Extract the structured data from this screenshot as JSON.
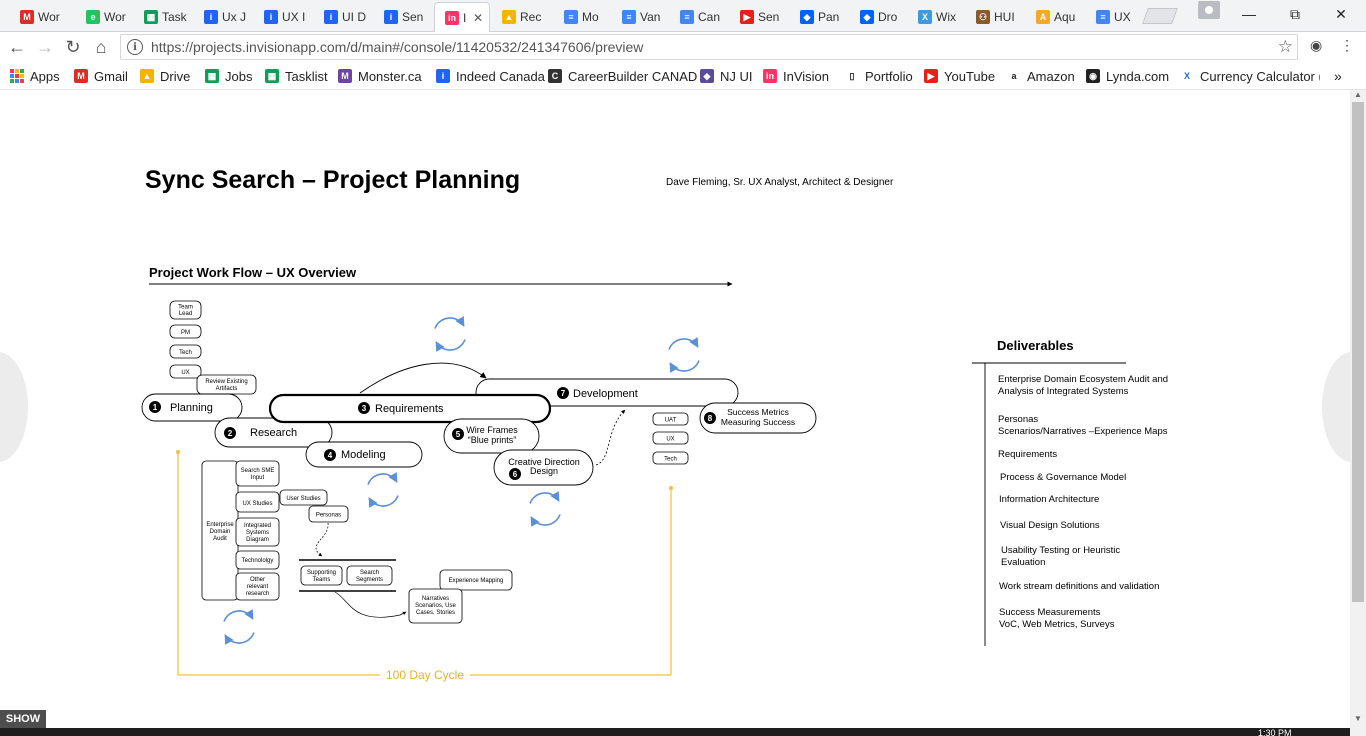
{
  "browser": {
    "tabs": [
      {
        "title": "Wor",
        "icon": "gmail-icon",
        "color": "#d93025",
        "glyph": "M"
      },
      {
        "title": "Wor",
        "icon": "evernote-icon",
        "color": "#2dbe60",
        "glyph": "e"
      },
      {
        "title": "Task",
        "icon": "sheets-icon",
        "color": "#0f9d58",
        "glyph": "▦"
      },
      {
        "title": "Ux J",
        "icon": "indeed-icon",
        "color": "#2164f3",
        "glyph": "i"
      },
      {
        "title": "UX I",
        "icon": "indeed-icon",
        "color": "#2164f3",
        "glyph": "i"
      },
      {
        "title": "UI D",
        "icon": "indeed-icon",
        "color": "#2164f3",
        "glyph": "i"
      },
      {
        "title": "Sen",
        "icon": "indeed-icon",
        "color": "#2164f3",
        "glyph": "i"
      },
      {
        "title": "I",
        "icon": "invision-icon",
        "color": "#ff3366",
        "glyph": "in",
        "active": true
      },
      {
        "title": "Rec",
        "icon": "drive-icon",
        "color": "#f4b400",
        "glyph": "▲"
      },
      {
        "title": "Mo",
        "icon": "docs-icon",
        "color": "#4285f4",
        "glyph": "≡"
      },
      {
        "title": "Van",
        "icon": "docs-icon",
        "color": "#4285f4",
        "glyph": "≡"
      },
      {
        "title": "Can",
        "icon": "docs-icon",
        "color": "#4285f4",
        "glyph": "≡"
      },
      {
        "title": "Sen",
        "icon": "youtube-icon",
        "color": "#e62117",
        "glyph": "▶"
      },
      {
        "title": "Pan",
        "icon": "dropbox-icon",
        "color": "#0061fe",
        "glyph": "◆"
      },
      {
        "title": "Dro",
        "icon": "dropbox-icon",
        "color": "#0061fe",
        "glyph": "◆"
      },
      {
        "title": "Wix",
        "icon": "wix-icon",
        "color": "#3b9ae1",
        "glyph": "X"
      },
      {
        "title": "HUI",
        "icon": "people-icon",
        "color": "#8a5a2b",
        "glyph": "⚇"
      },
      {
        "title": "Aqu",
        "icon": "aqua-icon",
        "color": "#f9a825",
        "glyph": "A"
      },
      {
        "title": "UX",
        "icon": "docs-icon",
        "color": "#4285f4",
        "glyph": "≡"
      }
    ],
    "url": "https://projects.invisionapp.com/d/main#/console/11420532/241347606/preview",
    "bookmarks": [
      {
        "label": "Apps",
        "icon": "apps-grid-icon"
      },
      {
        "label": "Gmail",
        "icon": "gmail-icon",
        "color": "#d93025",
        "glyph": "M"
      },
      {
        "label": "Drive",
        "icon": "drive-icon",
        "color": "#f4b400",
        "glyph": "▲"
      },
      {
        "label": "Jobs",
        "icon": "sheets-icon",
        "color": "#0f9d58",
        "glyph": "▦"
      },
      {
        "label": "Tasklist",
        "icon": "sheets-icon",
        "color": "#0f9d58",
        "glyph": "▦"
      },
      {
        "label": "Monster.ca",
        "icon": "monster-icon",
        "color": "#6e45a5",
        "glyph": "M"
      },
      {
        "label": "Indeed Canada",
        "icon": "indeed-icon",
        "color": "#2164f3",
        "glyph": "i"
      },
      {
        "label": "CareerBuilder CANAD",
        "icon": "careerbuilder-icon",
        "color": "#333333",
        "glyph": "C"
      },
      {
        "label": "NJ UI",
        "icon": "diamond-icon",
        "color": "#5b4b9a",
        "glyph": "◆"
      },
      {
        "label": "InVision",
        "icon": "invision-icon",
        "color": "#ff3366",
        "glyph": "in"
      },
      {
        "label": "Portfolio",
        "icon": "page-icon",
        "color": "#ffffff",
        "glyph": "▯"
      },
      {
        "label": "YouTube",
        "icon": "youtube-icon",
        "color": "#e62117",
        "glyph": "▶"
      },
      {
        "label": "Amazon",
        "icon": "amazon-icon",
        "color": "#ffffff",
        "glyph": "a"
      },
      {
        "label": "Lynda.com",
        "icon": "lynda-icon",
        "color": "#222222",
        "glyph": "◉"
      },
      {
        "label": "Currency Calculator (",
        "icon": "xe-icon",
        "color": "#ffffff",
        "glyph": "X"
      }
    ],
    "more": "»"
  },
  "page": {
    "title": "Sync Search – Project Planning",
    "author": "Dave Fleming, Sr. UX Analyst, Architect & Designer",
    "workflow_title": "Project Work Flow – UX Overview",
    "show_label": "SHOW",
    "clock": "1:30 PM"
  },
  "diagram": {
    "roles": [
      "Team Lead",
      "PM",
      "Tech",
      "UX"
    ],
    "review": "Review Existing Artifacts",
    "phases": [
      {
        "num": "1",
        "label": "Planning"
      },
      {
        "num": "2",
        "label": "Research"
      },
      {
        "num": "3",
        "label": "Requirements"
      },
      {
        "num": "4",
        "label": "Modeling"
      },
      {
        "num": "5",
        "label": "Wire Frames",
        "label2": "“Blue prints”"
      },
      {
        "num": "6",
        "label": "Creative Direction",
        "label2": "Design"
      },
      {
        "num": "7",
        "label": "Development"
      },
      {
        "num": "8",
        "label": "Success Metrics",
        "label2": "Measuring Success"
      }
    ],
    "test_roles": [
      "UAT",
      "UX",
      "Tech"
    ],
    "enterprise": "Enterprise Domain Audit",
    "research_items": [
      "Search SME Input",
      "UX Studies",
      "Integrated Systems Diagram",
      "Technololgy",
      "Other relevant research"
    ],
    "user_studies": "User Studies",
    "personas": "Personas",
    "supporting_teams": "Supporting Teams",
    "search_segments": "Search Segments",
    "experience_mapping": "Experience Mapping",
    "narratives": "Narratives Scenarios, Use Cases, Stories",
    "cycle": "100 Day Cycle",
    "colors": {
      "cycle": "#f0c040",
      "loop": "#5b8fd6",
      "ink": "#000000"
    }
  },
  "deliverables": {
    "title": "Deliverables",
    "items": [
      [
        "Enterprise Domain Ecosystem Audit and",
        "Analysis of Integrated Systems"
      ],
      [
        "Personas",
        "Scenarios/Narratives –Experience Maps"
      ],
      [
        "Requirements"
      ],
      [
        "Process & Governance Model"
      ],
      [
        "Information Architecture"
      ],
      [
        "Visual Design Solutions"
      ],
      [
        "Usability Testing or Heuristic",
        "Evaluation"
      ],
      [
        "Work stream definitions and validation"
      ],
      [
        "Success Measurements",
        "VoC, Web Metrics, Surveys"
      ]
    ]
  }
}
